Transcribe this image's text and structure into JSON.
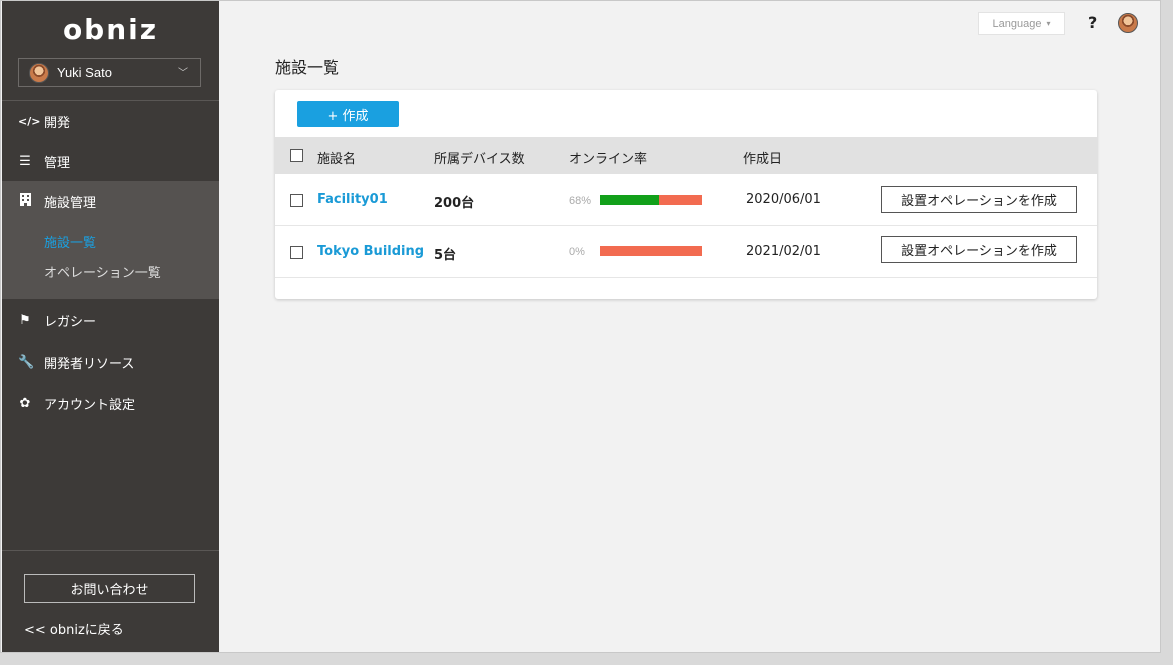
{
  "sidebar": {
    "logo": "obniz",
    "user": {
      "name": "Yuki Sato"
    },
    "nav": {
      "develop": "開発",
      "manage": "管理",
      "facility": "施設管理",
      "facility_list": "施設一覧",
      "operation_list": "オペレーション一覧",
      "legacy": "レガシー",
      "dev_resources": "開発者リソース",
      "account": "アカウント設定"
    },
    "contact_label": "お問い合わせ",
    "back_label": "<< obnizに戻る"
  },
  "header": {
    "language_label": "Language",
    "help_label": "?"
  },
  "main": {
    "title": "施設一覧",
    "create_label": "+ 作成",
    "columns": {
      "name": "施設名",
      "devices": "所属デバイス数",
      "online_rate": "オンライン率",
      "created": "作成日"
    },
    "rows": [
      {
        "name": "Facility01",
        "devices": "200台",
        "online_pct_label": "68%",
        "online_fraction": 0.58,
        "created": "2020/06/01",
        "action_label": "設置オペレーションを作成"
      },
      {
        "name": "Tokyo Building",
        "devices": "5台",
        "online_pct_label": "0%",
        "online_fraction": 0,
        "created": "2021/02/01",
        "action_label": "設置オペレーションを作成"
      }
    ]
  },
  "colors": {
    "sidebar_bg": "#3d3a38",
    "accent": "#1aa0e0",
    "online": "#12a01a",
    "offline": "#f26b50"
  }
}
